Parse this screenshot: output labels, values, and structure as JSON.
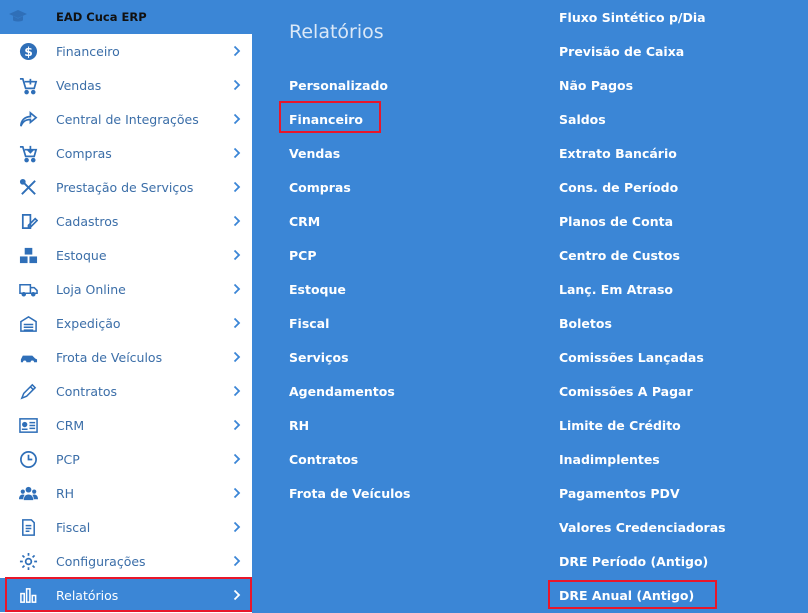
{
  "app": {
    "title": "EAD Cuca ERP",
    "logo_icon": "graduation-cap-icon"
  },
  "sidebar": {
    "items": [
      {
        "label": "Financeiro",
        "icon": "dollar-icon"
      },
      {
        "label": "Vendas",
        "icon": "cart-icon"
      },
      {
        "label": "Central de Integrações",
        "icon": "share-icon"
      },
      {
        "label": "Compras",
        "icon": "cart-down-icon"
      },
      {
        "label": "Prestação de Serviços",
        "icon": "tools-icon"
      },
      {
        "label": "Cadastros",
        "icon": "edit-icon"
      },
      {
        "label": "Estoque",
        "icon": "boxes-icon"
      },
      {
        "label": "Loja Online",
        "icon": "truck-icon"
      },
      {
        "label": "Expedição",
        "icon": "warehouse-icon"
      },
      {
        "label": "Frota de Veículos",
        "icon": "car-icon"
      },
      {
        "label": "Contratos",
        "icon": "pen-icon"
      },
      {
        "label": "CRM",
        "icon": "id-card-icon"
      },
      {
        "label": "PCP",
        "icon": "clock-icon"
      },
      {
        "label": "RH",
        "icon": "users-icon"
      },
      {
        "label": "Fiscal",
        "icon": "document-icon"
      },
      {
        "label": "Configurações",
        "icon": "gear-icon"
      },
      {
        "label": "Relatórios",
        "icon": "bar-chart-icon",
        "active": true
      }
    ]
  },
  "reports_menu": {
    "title": "Relatórios",
    "items": [
      "Personalizado",
      "Financeiro",
      "Vendas",
      "Compras",
      "CRM",
      "PCP",
      "Estoque",
      "Fiscal",
      "Serviços",
      "Agendamentos",
      "RH",
      "Contratos",
      "Frota de Veículos"
    ]
  },
  "financeiro_menu": {
    "items": [
      "Fluxo Sintético p/Dia",
      "Previsão de Caixa",
      "Não Pagos",
      "Saldos",
      "Extrato Bancário",
      "Cons. de Período",
      "Planos de Conta",
      "Centro de Custos",
      "Lanç. Em Atraso",
      "Boletos",
      "Comissões Lançadas",
      "Comissões A Pagar",
      "Limite de Crédito",
      "Inadimplentes",
      "Pagamentos PDV",
      "Valores Credenciadoras",
      "DRE Período (Antigo)",
      "DRE Anual (Antigo)"
    ]
  },
  "colors": {
    "accent": "#3b86d6",
    "highlight": "#e8162a",
    "sidebar_text": "#3b6ea8"
  }
}
